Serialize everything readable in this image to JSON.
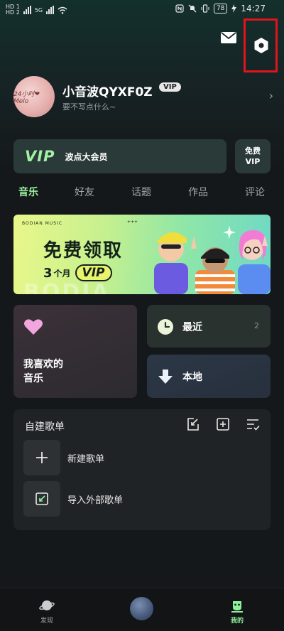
{
  "status_bar": {
    "sim_labels": [
      "HD 1",
      "HD 2"
    ],
    "network": "5G",
    "battery": "78",
    "time": "14:27"
  },
  "profile": {
    "avatar_text": "24小时❤Melo",
    "username": "小音波QYXF0Z",
    "vip_badge": "VIP",
    "bio": "要不写点什么~"
  },
  "vip_card": {
    "logo": "VIP",
    "label": "波点大会员"
  },
  "free_vip": {
    "line1": "免费",
    "line2": "VIP"
  },
  "tabs": [
    {
      "label": "音乐",
      "active": true
    },
    {
      "label": "好友",
      "active": false
    },
    {
      "label": "话题",
      "active": false
    },
    {
      "label": "作品",
      "active": false
    },
    {
      "label": "评论",
      "active": false
    }
  ],
  "banner": {
    "brand": "BODIAN MUSIC",
    "stars": "+++",
    "headline": "免费领取",
    "sub_number": "3",
    "sub_unit": "个月",
    "sub_vip": "VIP",
    "watermark": "BODIA"
  },
  "cards": {
    "favorites_line1": "我喜欢的",
    "favorites_line2": "音乐",
    "recent_label": "最近",
    "recent_count": "2",
    "local_label": "本地"
  },
  "playlists": {
    "title": "自建歌单",
    "new_playlist": "新建歌单",
    "import_playlist": "导入外部歌单"
  },
  "bottom_nav": [
    {
      "label": "发现",
      "active": false
    },
    {
      "label": "我的",
      "active": true
    }
  ],
  "colors": {
    "accent_green": "#9af0a2",
    "highlight_red": "#e0141c",
    "background": "#15181a"
  }
}
